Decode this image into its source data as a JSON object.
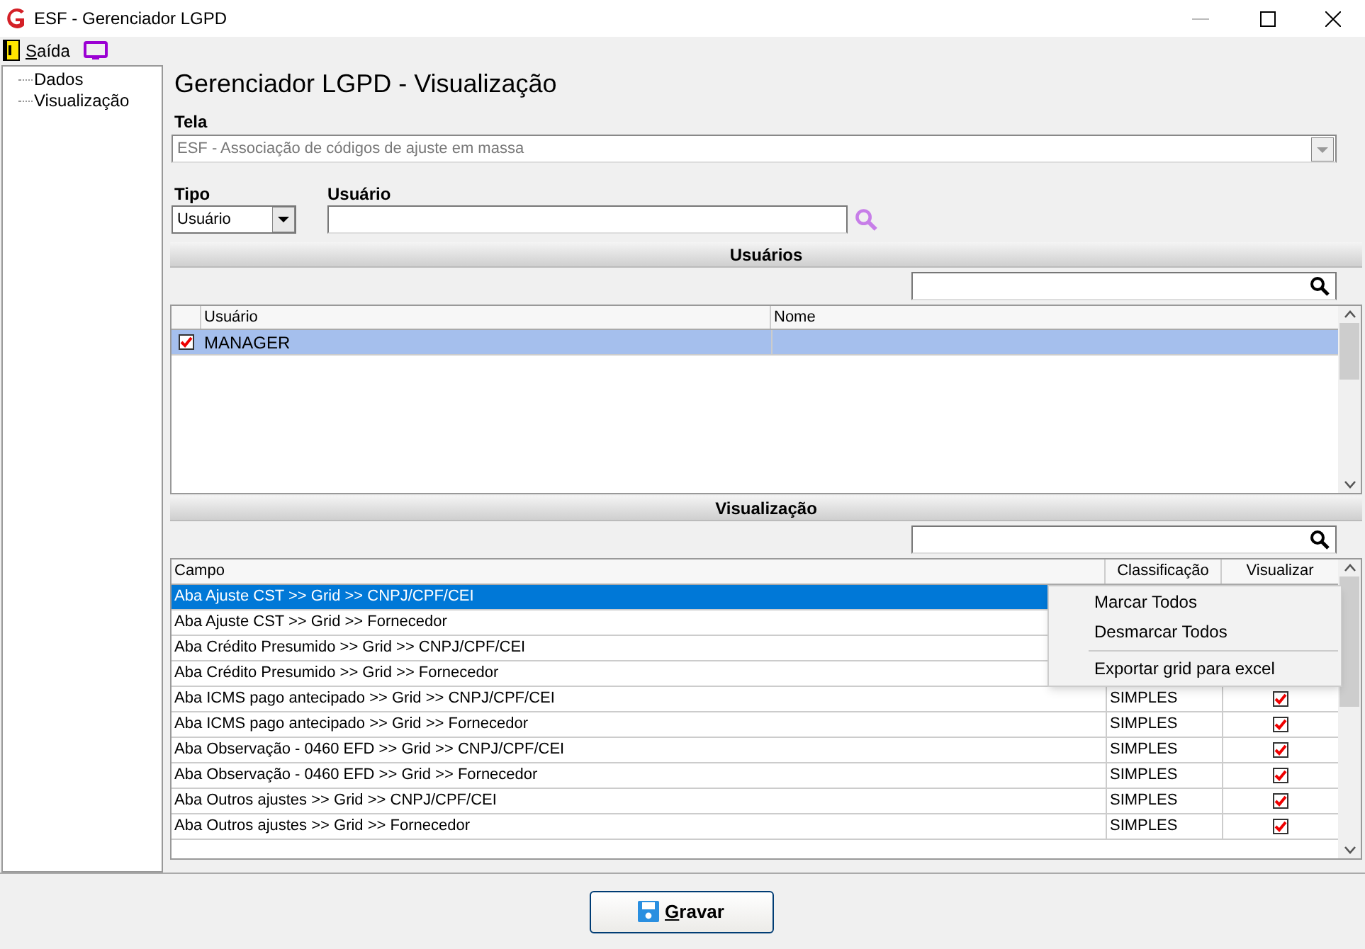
{
  "window": {
    "title": "ESF - Gerenciador LGPD"
  },
  "menu": [
    {
      "label": "Saída"
    }
  ],
  "sidebar": {
    "items": [
      {
        "label": "Dados"
      },
      {
        "label": "Visualização"
      }
    ]
  },
  "heading": "Gerenciador LGPD - Visualização",
  "tela": {
    "label": "Tela",
    "value": "ESF - Associação de códigos de ajuste em massa",
    "disabled": true
  },
  "tipo": {
    "label": "Tipo",
    "value": "Usuário"
  },
  "usuario": {
    "label": "Usuário"
  },
  "usuarios": {
    "title": "Usuários",
    "columns": [
      "Usuário",
      "Nome"
    ],
    "rows": [
      {
        "checked": true,
        "selected": true,
        "usuario": "MANAGER"
      }
    ]
  },
  "visualizacao": {
    "title": "Visualização",
    "columns": [
      "Campo",
      "Classificação",
      "Visualizar"
    ],
    "rows": [
      {
        "campo": "Aba Ajuste CST >> Grid >> CNPJ/CPF/CEI",
        "selected": true
      },
      {
        "campo": "Aba Ajuste CST >> Grid >> Fornecedor",
        "selected": false
      },
      {
        "campo": "Aba Crédito Presumido >> Grid >> CNPJ/CPF/CEI",
        "selected": false
      },
      {
        "campo": "Aba Crédito Presumido >> Grid >> Fornecedor",
        "selected": false
      },
      {
        "campo": "Aba ICMS pago antecipado >> Grid >> CNPJ/CPF/CEI",
        "selected": false,
        "classificacao": "SIMPLES",
        "checked": true
      },
      {
        "campo": "Aba ICMS pago antecipado >> Grid >> Fornecedor",
        "selected": false,
        "classificacao": "SIMPLES",
        "checked": true
      },
      {
        "campo": "Aba Observação - 0460 EFD >> Grid >> CNPJ/CPF/CEI",
        "selected": false,
        "classificacao": "SIMPLES",
        "checked": true
      },
      {
        "campo": "Aba Observação - 0460 EFD >> Grid >> Fornecedor",
        "selected": false,
        "classificacao": "SIMPLES",
        "checked": true
      },
      {
        "campo": "Aba Outros ajustes >> Grid >> CNPJ/CPF/CEI",
        "selected": false,
        "classificacao": "SIMPLES",
        "checked": true
      },
      {
        "campo": "Aba Outros ajustes >> Grid >> Fornecedor",
        "selected": false,
        "classificacao": "SIMPLES",
        "checked": true
      }
    ]
  },
  "context_menu": [
    {
      "label": "Marcar Todos",
      "kind": "item"
    },
    {
      "label": "Desmarcar Todos",
      "kind": "item"
    },
    {
      "kind": "separator"
    },
    {
      "label": "Exportar grid para excel",
      "kind": "item"
    }
  ],
  "save_button": "Gravar"
}
